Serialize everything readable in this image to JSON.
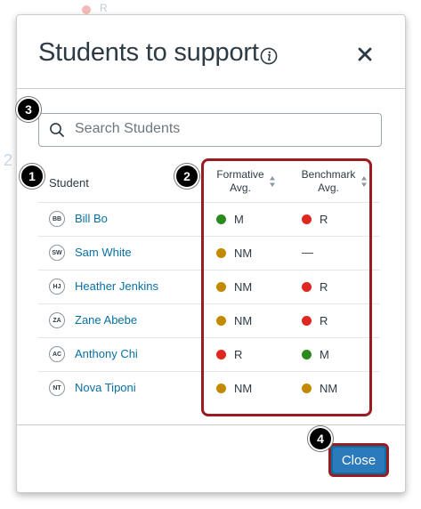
{
  "background": {
    "fragment_text": "R",
    "fragment_number": "2"
  },
  "modal": {
    "title": "Students to support",
    "info_icon": "info-icon",
    "close_icon": "close-icon",
    "search": {
      "placeholder": "Search Students",
      "value": "",
      "icon": "search-icon"
    },
    "columns": {
      "student": "Student",
      "formative_line1": "Formative",
      "formative_line2": "Avg.",
      "benchmark_line1": "Benchmark",
      "benchmark_line2": "Avg."
    },
    "students": [
      {
        "initials": "BB",
        "name": "Bill Bo",
        "formative": "M",
        "formative_color": "#2a8a1e",
        "benchmark": "R",
        "benchmark_color": "#e0271f"
      },
      {
        "initials": "SW",
        "name": "Sam White",
        "formative": "NM",
        "formative_color": "#c38a00",
        "benchmark": "—",
        "benchmark_color": ""
      },
      {
        "initials": "HJ",
        "name": "Heather Jenkins",
        "formative": "NM",
        "formative_color": "#c38a00",
        "benchmark": "R",
        "benchmark_color": "#e0271f"
      },
      {
        "initials": "ZA",
        "name": "Zane Abebe",
        "formative": "NM",
        "formative_color": "#c38a00",
        "benchmark": "R",
        "benchmark_color": "#e0271f"
      },
      {
        "initials": "AC",
        "name": "Anthony Chi",
        "formative": "R",
        "formative_color": "#e0271f",
        "benchmark": "M",
        "benchmark_color": "#2a8a1e"
      },
      {
        "initials": "NT",
        "name": "Nova Tiponi",
        "formative": "NM",
        "formative_color": "#c38a00",
        "benchmark": "NM",
        "benchmark_color": "#c38a00"
      }
    ],
    "close_button": "Close"
  },
  "callouts": [
    "1",
    "2",
    "3",
    "4"
  ],
  "colors": {
    "accent": "#0770a3",
    "button": "#2b7abc",
    "highlight": "#9b1b23",
    "mastery_m": "#2a8a1e",
    "mastery_nm": "#c38a00",
    "mastery_r": "#e0271f"
  }
}
